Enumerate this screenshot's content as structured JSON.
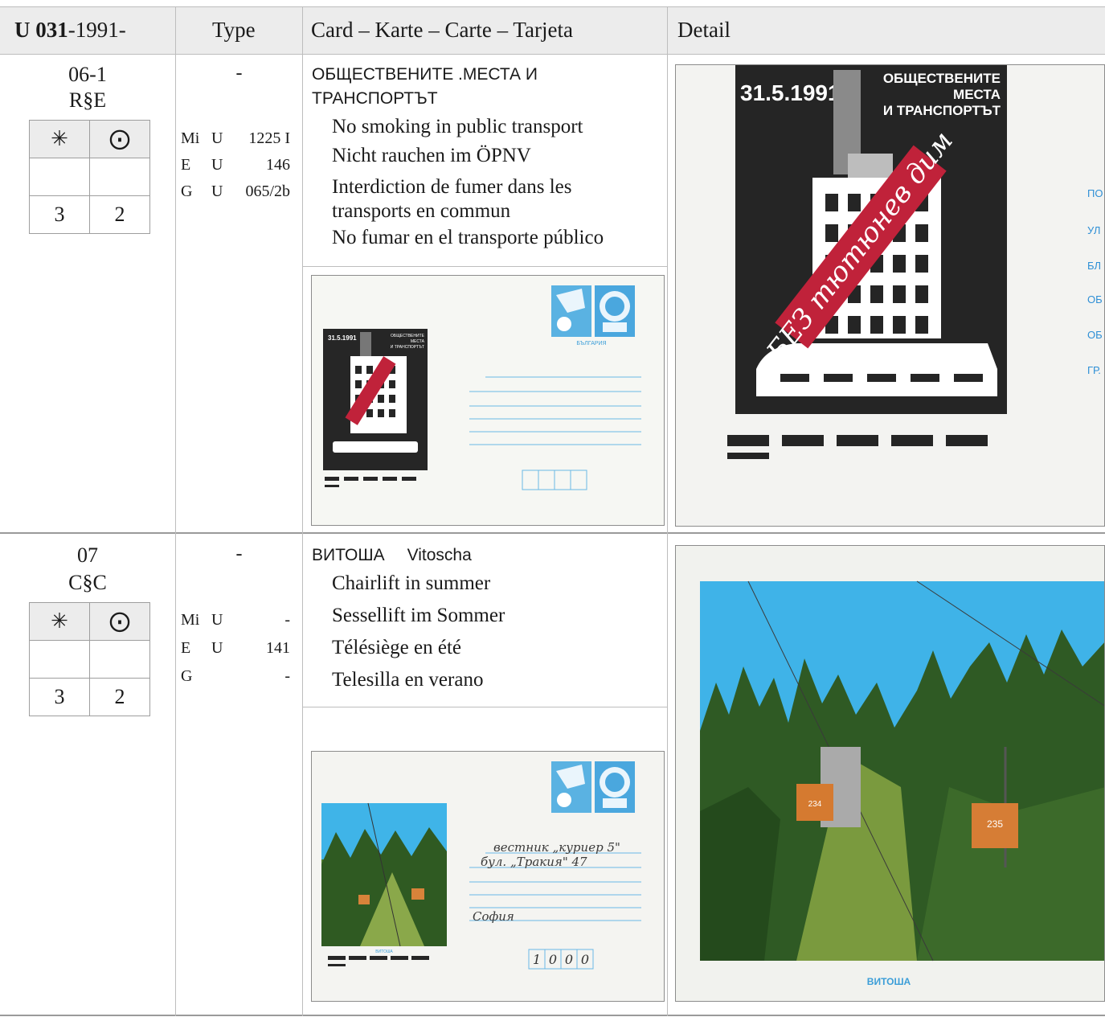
{
  "header": {
    "title_bold": "U 031",
    "title_rest": "-1991-",
    "col_type": "Type",
    "col_card": "Card – Karte – Carte – Tarjeta",
    "col_detail": "Detail"
  },
  "condition_symbols": {
    "mint": "✳",
    "used": "⨀"
  },
  "entries": [
    {
      "number": "06-1",
      "code": "R§E",
      "type": "-",
      "values": {
        "mint": "3",
        "used": "2"
      },
      "catalog": [
        {
          "k": "Mi",
          "s": "U",
          "n": "1225 I"
        },
        {
          "k": "E",
          "s": "U",
          "n": "146"
        },
        {
          "k": "G",
          "s": "U",
          "n": "065/2b"
        }
      ],
      "title_ru_1": "ОБЩЕСТВЕНИТЕ .МЕСТА И",
      "title_ru_2": "ТРАНСПОРТЪТ",
      "desc_en": "No smoking in public transport",
      "desc_de": "Nicht rauchen im ÖPNV",
      "desc_fr_1": "Interdiction de fumer dans les",
      "desc_fr_2": "transports en commun",
      "desc_es": "No fumar en el transporte público",
      "image": {
        "date": "31.5.1991",
        "head_1": "ОБЩЕСТВЕНИТЕ",
        "head_2": "МЕСТА",
        "head_3": "И ТРАНСПОРТЪТ",
        "banner": "БЕЗ тютюнев дим",
        "country": "БЪЛГАРИЯ",
        "addr": [
          "ПО",
          "УЛ",
          "БЛ",
          "ОБ",
          "ОБ",
          "ГР."
        ]
      }
    },
    {
      "number": "07",
      "code": "C§C",
      "type": "-",
      "values": {
        "mint": "3",
        "used": "2"
      },
      "catalog": [
        {
          "k": "Mi",
          "s": "U",
          "n": "-"
        },
        {
          "k": "E",
          "s": "U",
          "n": "141"
        },
        {
          "k": "G",
          "s": "",
          "n": "-"
        }
      ],
      "title_ru": "ВИТОША",
      "title_lat": "Vitoscha",
      "desc_en": "Chairlift in summer",
      "desc_de": "Sessellift im Sommer",
      "desc_fr": "Télésiège en été",
      "desc_es": "Telesilla en verano",
      "image": {
        "caption": "ВИТОША",
        "cabin_1": "234",
        "cabin_2": "235",
        "hand_1": "вестник „куриер 5\"",
        "hand_2": "бул. „Тракия\" 47",
        "hand_3": "София",
        "postcode": [
          "1",
          "0",
          "0",
          "0"
        ]
      }
    }
  ],
  "colors": {
    "header_bg": "#ececec",
    "grid": "#bdbdbd",
    "poster_dark": "#262626",
    "banner_red": "#c0223a",
    "stamp_blue": "#3fa3dc",
    "sky": "#3fb4e8"
  }
}
